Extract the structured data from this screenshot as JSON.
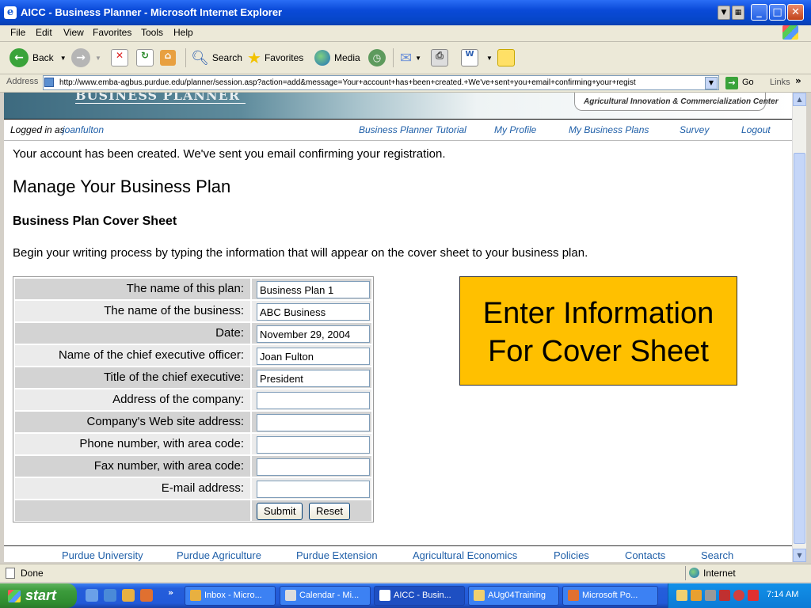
{
  "window": {
    "title": "AICC - Business Planner - Microsoft Internet Explorer"
  },
  "menu": [
    "File",
    "Edit",
    "View",
    "Favorites",
    "Tools",
    "Help"
  ],
  "toolbar": {
    "back": "Back",
    "search": "Search",
    "favorites": "Favorites",
    "media": "Media"
  },
  "address": {
    "label": "Address",
    "url": "http://www.emba-agbus.purdue.edu/planner/session.asp?action=add&message=Your+account+has+been+created.+We've+sent+you+email+confirming+your+regist",
    "go": "Go",
    "links": "Links"
  },
  "banner": {
    "title": "BUSINESS PLANNER",
    "org": "Agricultural Innovation & Commercialization Center"
  },
  "nav": {
    "logged_in_as": "Logged in as",
    "user": "joanfulton",
    "links": [
      "Business Planner Tutorial",
      "My Profile",
      "My Business Plans",
      "Survey",
      "Logout"
    ]
  },
  "page": {
    "message": "Your account has been created. We've sent you email confirming your registration.",
    "heading": "Manage Your Business Plan",
    "subheading": "Business Plan Cover Sheet",
    "intro": "Begin your writing process by typing the information that will appear on the cover sheet to your business plan."
  },
  "form": {
    "fields": [
      {
        "label": "The name of this plan:",
        "value": "Business Plan 1"
      },
      {
        "label": "The name of the business:",
        "value": "ABC Business"
      },
      {
        "label": "Date:",
        "value": "November 29, 2004"
      },
      {
        "label": "Name of the chief executive officer:",
        "value": "Joan Fulton"
      },
      {
        "label": "Title of the chief executive:",
        "value": "President"
      },
      {
        "label": "Address of the company:",
        "value": ""
      },
      {
        "label": "Company's Web site address:",
        "value": ""
      },
      {
        "label": "Phone number, with area code:",
        "value": ""
      },
      {
        "label": "Fax number, with area code:",
        "value": ""
      },
      {
        "label": "E-mail address:",
        "value": ""
      }
    ],
    "submit": "Submit",
    "reset": "Reset"
  },
  "callout": {
    "line1": "Enter Information",
    "line2": "For Cover Sheet",
    "color": "#ffc000"
  },
  "footer": {
    "links": [
      "Purdue University",
      "Purdue Agriculture",
      "Purdue Extension",
      "Agricultural Economics",
      "Policies",
      "Contacts",
      "Search"
    ]
  },
  "status": {
    "text": "Done",
    "zone": "Internet"
  },
  "taskbar": {
    "start": "start",
    "tasks": [
      "Inbox - Micro...",
      "Calendar - Mi...",
      "AICC - Busin...",
      "AUg04Training",
      "Microsoft Po..."
    ],
    "clock": "7:14 AM"
  },
  "colors": {
    "link": "#1f5fa8",
    "xp_blue": "#0a4ad8"
  }
}
